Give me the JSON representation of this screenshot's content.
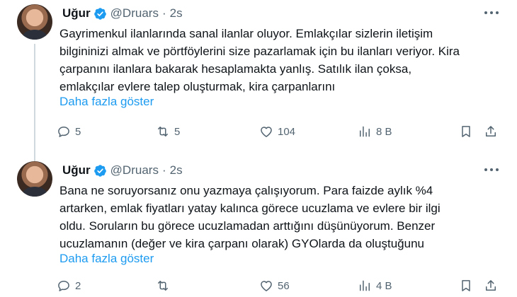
{
  "tweets": [
    {
      "author": {
        "name": "Uğur",
        "handle": "@Druars"
      },
      "separator": "·",
      "time": "2s",
      "lines": [
        "Gayrimenkul ilanlarında sanal ilanlar oluyor. Emlakçılar sizlerin iletişim",
        "bilgininizi almak ve pörtföylerini size pazarlamak için bu ilanları veriyor. Kira",
        "çarpanını ilanlara bakarak hesaplamakta yanlış. Satılık ilan çoksa,",
        "emlakçılar evlere talep oluşturmak, kira çarpanlarını"
      ],
      "show_more": "Daha fazla göster",
      "stats": {
        "replies": "5",
        "retweets": "5",
        "likes": "104",
        "views": "8 B"
      },
      "icons": {
        "reply": "reply-icon",
        "retweet": "retweet-icon",
        "like": "heart-icon",
        "views": "views-icon",
        "bookmark": "bookmark-icon",
        "share": "share-icon"
      }
    },
    {
      "author": {
        "name": "Uğur",
        "handle": "@Druars"
      },
      "separator": "·",
      "time": "2s",
      "lines": [
        "Bana ne soruyorsanız onu yazmaya çalışıyorum. Para faizde aylık %4",
        "artarken, emlak fiyatları yatay kalınca görece ucuzlama ve evlere bir ilgi",
        "oldu. Soruların bu görece ucuzlamadan arttığını düşünüyorum. Benzer",
        "ucuzlamanın (değer ve kira çarpanı olarak) GYOlarda da oluştuğunu"
      ],
      "show_more": "Daha fazla göster",
      "stats": {
        "replies": "2",
        "retweets": "",
        "likes": "56",
        "views": "4 B"
      },
      "icons": {
        "reply": "reply-icon",
        "retweet": "retweet-icon",
        "like": "heart-icon",
        "views": "views-icon",
        "bookmark": "bookmark-icon",
        "share": "share-icon"
      }
    }
  ],
  "colors": {
    "text": "#0f1419",
    "secondary": "#536471",
    "link": "#1d9bf0",
    "verified": "#1d9bf0",
    "thread_line": "#cfd9de"
  }
}
